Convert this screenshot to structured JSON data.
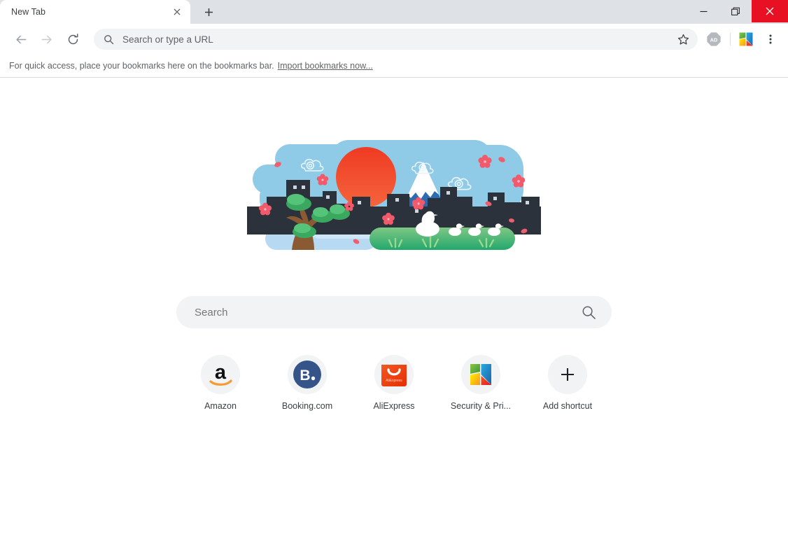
{
  "window": {
    "controls": {
      "minimize": "minimize-button",
      "restore": "restore-button",
      "close": "close-button"
    },
    "close_color": "#e81123"
  },
  "tabstrip": {
    "tabs": [
      {
        "title": "New Tab",
        "active": true,
        "close_label": "Close tab"
      }
    ],
    "new_tab_label": "New tab",
    "strip_bg": "#dee1e6"
  },
  "toolbar": {
    "back_label": "Back",
    "forward_label": "Forward",
    "reload_label": "Reload this page",
    "omnibox": {
      "value": "",
      "placeholder": "Search or type a URL",
      "search_icon": "search-icon",
      "bookmark_icon": "star-icon"
    },
    "adblock_badge": "AD",
    "extension_icon": "avg-extension-icon",
    "menu_icon": "three-dot-menu-icon"
  },
  "bookmark_bar": {
    "message": "For quick access, place your bookmarks here on the bookmarks bar.",
    "import_link": "Import bookmarks now..."
  },
  "doodle": {
    "name": "japan-mount-fuji-illustration",
    "colors": {
      "sky": "#8fcae6",
      "cloud": "#bde0f0",
      "sun_top": "#ef4327",
      "sun_bottom": "#f05a33",
      "mountain": "#2f6fb5",
      "snow": "#ffffff",
      "city": "#2b323c",
      "grass_top": "#7dc67f",
      "grass_bottom": "#2fa86e",
      "water": "#b8d9f2",
      "trunk": "#8a5a33",
      "foliage": "#4caf6d",
      "blossom": "#f2596a",
      "duck": "#ffffff"
    },
    "elements": {
      "ducks": 4,
      "blossoms": 12,
      "clouds": 3,
      "trees": 3
    }
  },
  "realbox": {
    "value": "",
    "placeholder": "Search",
    "search_icon": "search-icon"
  },
  "shortcuts": [
    {
      "label": "Amazon",
      "icon": "amazon-icon",
      "name": "shortcut-amazon"
    },
    {
      "label": "Booking.com",
      "icon": "booking-icon",
      "name": "shortcut-booking"
    },
    {
      "label": "AliExpress",
      "icon": "aliexpress-icon",
      "name": "shortcut-aliexpress"
    },
    {
      "label": "Security & Pri...",
      "icon": "avg-icon",
      "name": "shortcut-security-privacy"
    },
    {
      "label": "Add shortcut",
      "icon": "plus-icon",
      "name": "add-shortcut-button"
    }
  ]
}
